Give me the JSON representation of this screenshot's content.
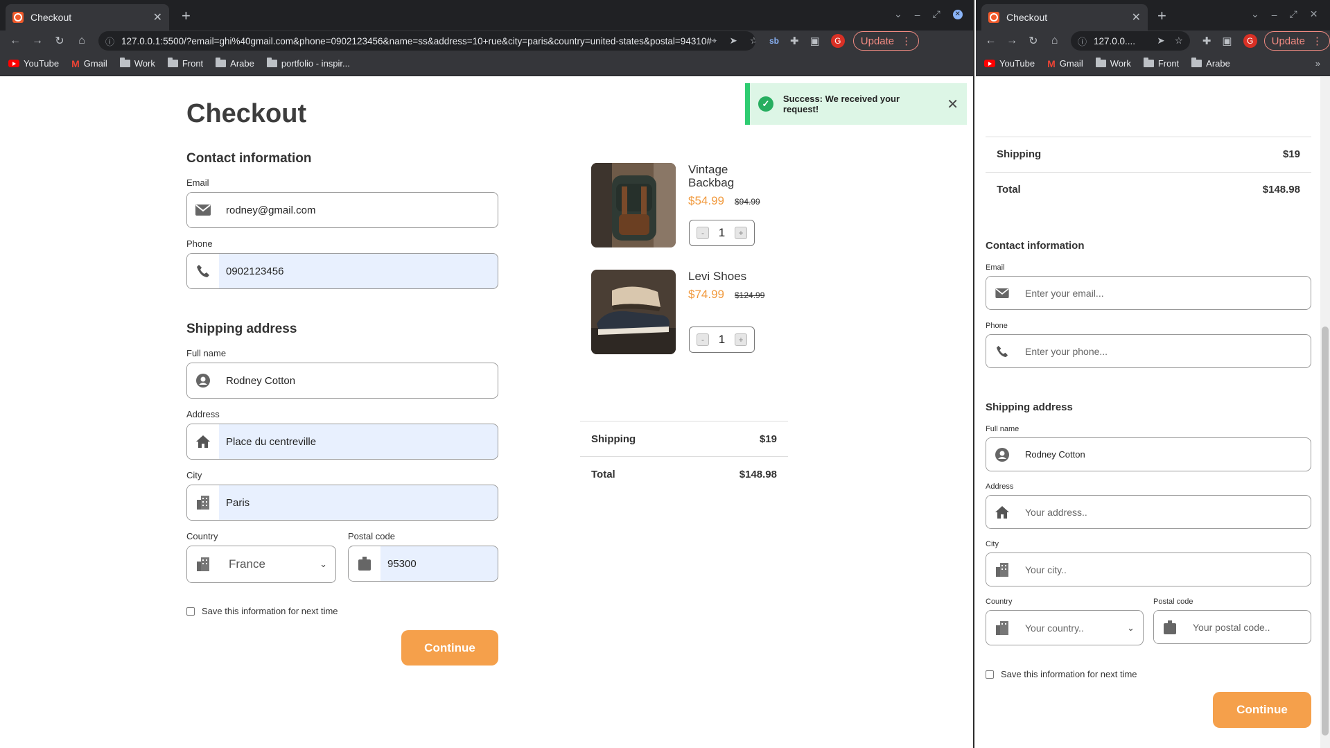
{
  "left": {
    "tab_title": "Checkout",
    "url": "127.0.0.1:5500/?email=ghi%40gmail.com&phone=0902123456&name=ss&address=10+rue&city=paris&country=united-states&postal=94310#",
    "update_label": "Update",
    "bookmarks": [
      "YouTube",
      "Gmail",
      "Work",
      "Front",
      "Arabe",
      "portfolio - inspir..."
    ],
    "page_title": "Checkout",
    "contact_heading": "Contact information",
    "email_label": "Email",
    "email_value": "rodney@gmail.com",
    "phone_label": "Phone",
    "phone_value": "0902123456",
    "shipping_heading": "Shipping address",
    "fullname_label": "Full name",
    "fullname_value": "Rodney Cotton",
    "address_label": "Address",
    "address_value": "Place du centreville",
    "city_label": "City",
    "city_value": "Paris",
    "country_label": "Country",
    "country_value": "France",
    "postal_label": "Postal code",
    "postal_value": "95300",
    "save_label": "Save this information for next time",
    "continue_label": "Continue",
    "toast_text": "Success: We received your request!",
    "products": [
      {
        "name": "Vintage Backbag",
        "price": "$54.99",
        "old_price": "$94.99",
        "qty": "1"
      },
      {
        "name": "Levi Shoes",
        "price": "$74.99",
        "old_price": "$124.99",
        "qty": "1"
      }
    ],
    "shipping_label": "Shipping",
    "shipping_value": "$19",
    "total_label": "Total",
    "total_value": "$148.98"
  },
  "right": {
    "tab_title": "Checkout",
    "url": "127.0.0....",
    "update_label": "Update",
    "bookmarks": [
      "YouTube",
      "Gmail",
      "Work",
      "Front",
      "Arabe"
    ],
    "shipping_label": "Shipping",
    "shipping_value": "$19",
    "total_label": "Total",
    "total_value": "$148.98",
    "contact_heading": "Contact information",
    "email_label": "Email",
    "email_placeholder": "Enter your email...",
    "phone_label": "Phone",
    "phone_placeholder": "Enter your phone...",
    "shipping_heading": "Shipping address",
    "fullname_label": "Full name",
    "fullname_value": "Rodney Cotton",
    "address_label": "Address",
    "address_placeholder": "Your address..",
    "city_label": "City",
    "city_placeholder": "Your city..",
    "country_label": "Country",
    "country_placeholder": "Your country..",
    "postal_label": "Postal code",
    "postal_placeholder": "Your postal code..",
    "save_label": "Save this information for next time",
    "continue_label": "Continue"
  },
  "icons": {
    "minus": "-",
    "plus": "+",
    "quantity_decrease": "-",
    "quantity_increase": "+"
  },
  "colors": {
    "accent": "#f5a04b",
    "price": "#f19a3e",
    "success": "#2ecc71",
    "autofill": "#e8f0fe"
  }
}
